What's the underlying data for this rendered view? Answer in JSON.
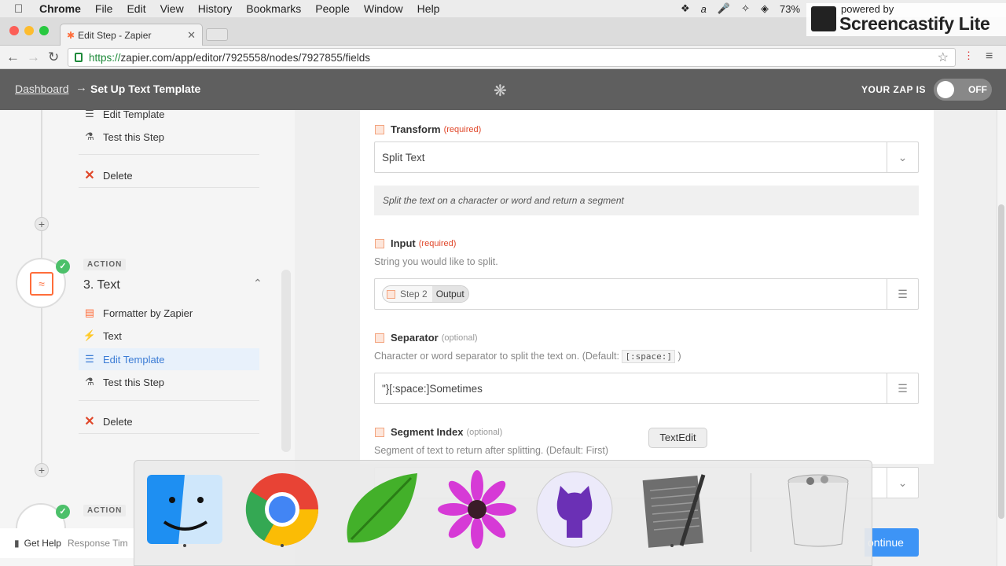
{
  "os_menu": {
    "app": "Chrome",
    "items": [
      "File",
      "Edit",
      "View",
      "History",
      "Bookmarks",
      "People",
      "Window",
      "Help"
    ],
    "battery": "73%"
  },
  "browser": {
    "tab_title": "Edit Step - Zapier",
    "url_https": "https://",
    "url_rest": "zapier.com/app/editor/7925558/nodes/7927855/fields"
  },
  "watermark": {
    "small": "powered by",
    "big": "Screencastify Lite"
  },
  "header": {
    "breadcrumb": "Dashboard",
    "title": "Set Up Text Template",
    "zap_label": "YOUR ZAP IS",
    "toggle": "OFF"
  },
  "sidebar": {
    "top_items": [
      {
        "label": "Edit Template",
        "icon": "lines-icon"
      },
      {
        "label": "Test this Step",
        "icon": "flask-icon"
      },
      {
        "label": "Delete",
        "icon": "x-icon"
      }
    ],
    "step_badge": "ACTION",
    "step_title": "3. Text",
    "step_items": [
      {
        "label": "Formatter by Zapier",
        "icon": "formatter-icon"
      },
      {
        "label": "Text",
        "icon": "bolt-icon"
      },
      {
        "label": "Edit Template",
        "icon": "lines-icon"
      },
      {
        "label": "Test this Step",
        "icon": "flask-icon"
      },
      {
        "label": "Delete",
        "icon": "x-icon"
      }
    ],
    "next_badge": "ACTION",
    "get_help": "Get Help",
    "response_time": "Response Tim"
  },
  "form": {
    "transform": {
      "label": "Transform",
      "tag": "(required)",
      "value": "Split Text",
      "description": "Split the text on a character or word and return a segment"
    },
    "input": {
      "label": "Input",
      "tag": "(required)",
      "help": "String you would like to split.",
      "pill_step": "Step 2",
      "pill_field": "Output"
    },
    "separator": {
      "label": "Separator",
      "tag": "(optional)",
      "help_pre": "Character or word separator to split the text on. (Default:",
      "help_code": "[:space:]",
      "help_post": ")",
      "value": "\"}[:space:]Sometimes"
    },
    "segment": {
      "label": "Segment Index",
      "tag": "(optional)",
      "help": "Segment of text to return after splitting. (Default: First)"
    },
    "continue": "ontinue"
  },
  "dock": {
    "tooltip": "TextEdit",
    "apps": [
      "Finder",
      "Google Chrome",
      "Coda",
      "Daisy",
      "GitHub Desktop",
      "TextEdit",
      "Trash"
    ]
  },
  "colors": {
    "accent": "#3d94f6",
    "zapier_orange": "#ff6d3a",
    "header_bg": "#5f5f5f",
    "success": "#4cc06a",
    "delete": "#e0472a"
  }
}
